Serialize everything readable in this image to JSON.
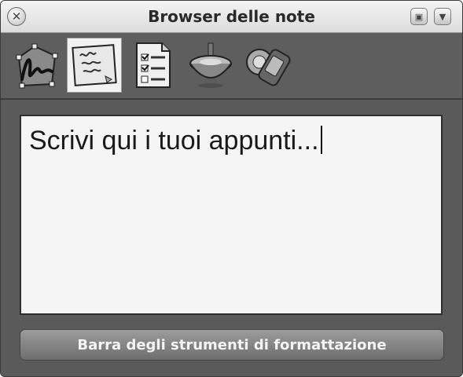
{
  "window": {
    "title": "Browser delle note",
    "close_glyph": "✕",
    "minimize_glyph": "▣",
    "menu_glyph": "▼"
  },
  "toolbar": {
    "tools": [
      {
        "icon": "handwriting-icon",
        "active": false
      },
      {
        "icon": "note-pad-icon",
        "active": true
      },
      {
        "icon": "checklist-icon",
        "active": false
      },
      {
        "icon": "spinning-top-icon",
        "active": false
      },
      {
        "icon": "pen-tablet-icon",
        "active": false
      }
    ]
  },
  "editor": {
    "text": "Scrivi qui i tuoi appunti..."
  },
  "format_bar": {
    "label": "Barra degli strumenti di formattazione"
  },
  "colors": {
    "window_bg": "#5a5a5a",
    "editor_bg": "#f5f5f5",
    "titlebar_bg": "#e6e6e6"
  }
}
